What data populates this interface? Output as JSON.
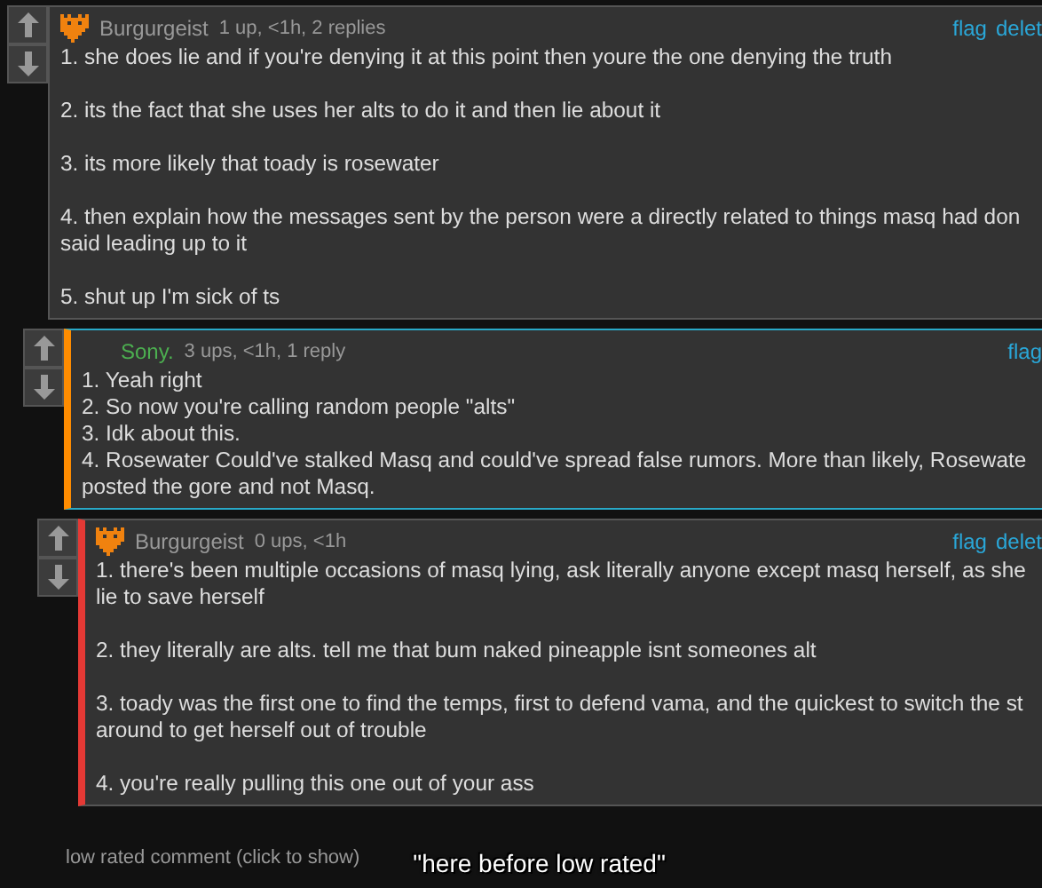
{
  "comments": [
    {
      "author": "Burgurgeist",
      "has_avatar": true,
      "is_op": false,
      "meta": "1 up, <1h, 2 replies",
      "actions": [
        "flag",
        "delet"
      ],
      "highlighted": false,
      "paragraphs": [
        "1. she does lie and if you're denying it at this point then youre the one denying the truth",
        "2. its the fact that she uses her alts to do it and then lie about it",
        "3. its more likely that toady is rosewater",
        "4. then explain how the messages sent by the person were a directly related to things masq had don\nsaid leading up to it",
        "5. shut up I'm sick of ts"
      ],
      "children": [
        {
          "author": "Sony.",
          "has_avatar": false,
          "is_op": true,
          "meta": "3 ups, <1h, 1 reply",
          "actions": [
            "flag"
          ],
          "highlighted": true,
          "color": "#ff8c00",
          "paragraphs": [
            "1. Yeah right\n2. So now you're calling random people \"alts\"\n3. Idk about this.\n4. Rosewater Could've stalked Masq and could've spread false rumors. More than likely, Rosewate\nposted the gore and not Masq."
          ],
          "children": [
            {
              "author": "Burgurgeist",
              "has_avatar": true,
              "is_op": false,
              "meta": "0 ups, <1h",
              "actions": [
                "flag",
                "delet"
              ],
              "highlighted": false,
              "color": "#e53935",
              "paragraphs": [
                "1. there's been multiple occasions of masq lying, ask literally anyone except masq herself, as she\nlie to save herself",
                "2. they literally are alts. tell me that bum naked pineapple isnt someones alt",
                "3. toady was the first one to find the temps, first to defend vama, and the quickest to switch the st\naround to get herself out of trouble",
                "4. you're really pulling this one out of your ass"
              ]
            }
          ]
        }
      ]
    }
  ],
  "low_rated": "low rated comment (click to show)",
  "caption": "\"here before low rated\""
}
